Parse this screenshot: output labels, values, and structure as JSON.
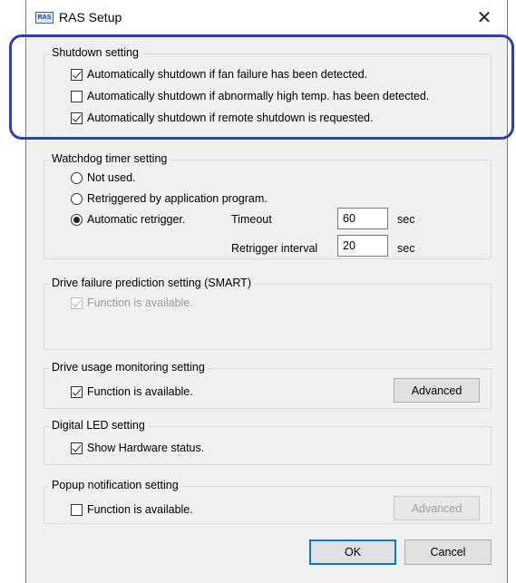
{
  "window": {
    "icon_text": "RAS",
    "title": "RAS Setup",
    "close_glyph": "✕"
  },
  "shutdown": {
    "legend": "Shutdown setting",
    "options": [
      {
        "label": "Automatically shutdown if fan failure has been detected.",
        "checked": true
      },
      {
        "label": "Automatically shutdown if abnormally high temp. has been detected.",
        "checked": false
      },
      {
        "label": "Automatically shutdown if remote shutdown is requested.",
        "checked": true
      }
    ]
  },
  "watchdog": {
    "legend": "Watchdog timer setting",
    "options": [
      {
        "label": "Not used.",
        "selected": false
      },
      {
        "label": "Retriggered by application program.",
        "selected": false
      },
      {
        "label": "Automatic retrigger.",
        "selected": true
      }
    ],
    "timeout_label": "Timeout",
    "timeout_value": "60",
    "timeout_unit": "sec",
    "interval_label": "Retrigger interval",
    "interval_value": "20",
    "interval_unit": "sec"
  },
  "smart": {
    "legend": "Drive failure prediction setting (SMART)",
    "option_label": "Function is available.",
    "checked": true,
    "enabled": false
  },
  "drive_usage": {
    "legend": "Drive usage monitoring setting",
    "option_label": "Function is available.",
    "checked": true,
    "advanced_label": "Advanced"
  },
  "digital_led": {
    "legend": "Digital LED setting",
    "option_label": "Show Hardware status.",
    "checked": true
  },
  "popup": {
    "legend": "Popup notification setting",
    "option_label": "Function is available.",
    "checked": false,
    "advanced_label": "Advanced",
    "advanced_enabled": false
  },
  "footer": {
    "ok_label": "OK",
    "cancel_label": "Cancel"
  },
  "annotation": {
    "color": "#2b3fb8"
  }
}
